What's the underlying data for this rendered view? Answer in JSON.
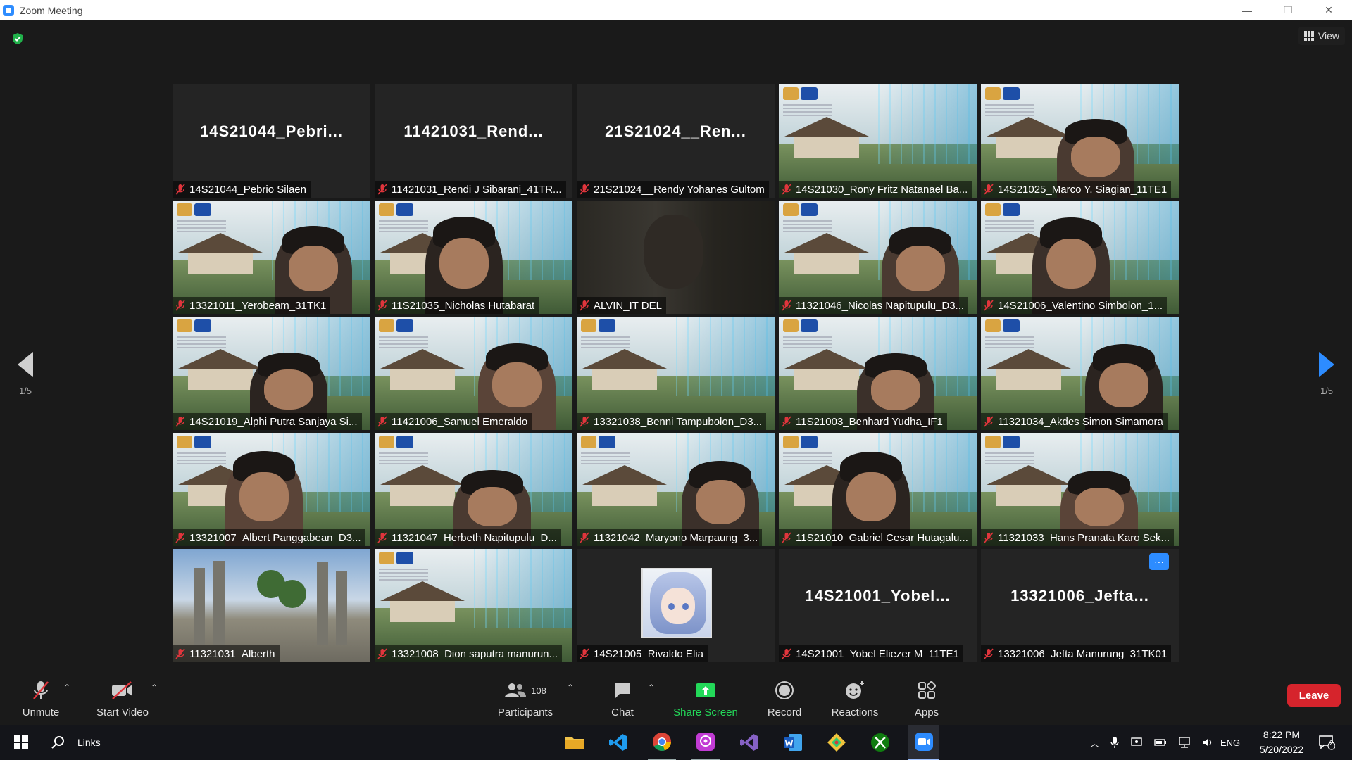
{
  "window": {
    "title": "Zoom Meeting",
    "min": "—",
    "max": "❐",
    "close": "✕"
  },
  "view": {
    "label": "View"
  },
  "pager": {
    "left": "1/5",
    "right": "1/5"
  },
  "tiles": [
    {
      "kind": "name",
      "big": "14S21044_Pebri...",
      "label": "14S21044_Pebrio Silaen"
    },
    {
      "kind": "name",
      "big": "11421031_Rend...",
      "label": "11421031_Rendi J Sibarani_41TR..."
    },
    {
      "kind": "name",
      "big": "21S21024__Ren...",
      "label": "21S21024__Rendy Yohanes Gultom"
    },
    {
      "kind": "campus",
      "label": "14S21030_Rony Fritz Natanael Ba..."
    },
    {
      "kind": "campus-person",
      "label": "14S21025_Marco Y. Siagian_11TE1"
    },
    {
      "kind": "campus-person",
      "label": "13321011_Yerobeam_31TK1"
    },
    {
      "kind": "campus-person",
      "label": "11S21035_Nicholas Hutabarat"
    },
    {
      "kind": "camera",
      "label": "ALVIN_IT DEL"
    },
    {
      "kind": "campus-person",
      "label": "11321046_Nicolas Napitupulu_D3..."
    },
    {
      "kind": "campus-person",
      "label": "14S21006_Valentino Simbolon_1..."
    },
    {
      "kind": "campus-person",
      "label": "14S21019_Alphi Putra Sanjaya Si..."
    },
    {
      "kind": "campus-person",
      "label": "11421006_Samuel Emeraldo"
    },
    {
      "kind": "campus",
      "label": "13321038_Benni Tampubolon_D3..."
    },
    {
      "kind": "campus-person",
      "label": "11S21003_Benhard Yudha_IF1"
    },
    {
      "kind": "campus-person",
      "label": "11321034_Akdes Simon Simamora"
    },
    {
      "kind": "campus-person",
      "label": "13321007_Albert Panggabean_D3..."
    },
    {
      "kind": "campus-person",
      "label": "11321047_Herbeth Napitupulu_D..."
    },
    {
      "kind": "campus-person",
      "label": "11321042_Maryono Marpaung_3..."
    },
    {
      "kind": "campus-person",
      "label": "11S21010_Gabriel Cesar Hutagalu..."
    },
    {
      "kind": "campus-person",
      "label": "11321033_Hans Pranata Karo Sek..."
    },
    {
      "kind": "gate",
      "label": "11321031_Alberth"
    },
    {
      "kind": "campus",
      "label": "13321008_Dion saputra manurun..."
    },
    {
      "kind": "avatar",
      "label": "14S21005_Rivaldo Elia"
    },
    {
      "kind": "name",
      "big": "14S21001_Yobel...",
      "label": "14S21001_Yobel Eliezer M_11TE1"
    },
    {
      "kind": "name-more",
      "big": "13321006_Jefta...",
      "label": "13321006_Jefta Manurung_31TK01",
      "more": "···"
    }
  ],
  "toolbar": {
    "unmute": "Unmute",
    "start_video": "Start Video",
    "participants": "Participants",
    "participants_count": "108",
    "chat": "Chat",
    "share_screen": "Share Screen",
    "record": "Record",
    "reactions": "Reactions",
    "apps": "Apps",
    "leave": "Leave"
  },
  "taskbar": {
    "search_label": "Links",
    "lang": "ENG",
    "time": "8:22 PM",
    "date": "5/20/2022",
    "notif_count": "2"
  },
  "colors": {
    "accent": "#2d8cff",
    "leave": "#d6242c",
    "active_speaker": "#b7d94c",
    "share": "#23d959"
  }
}
